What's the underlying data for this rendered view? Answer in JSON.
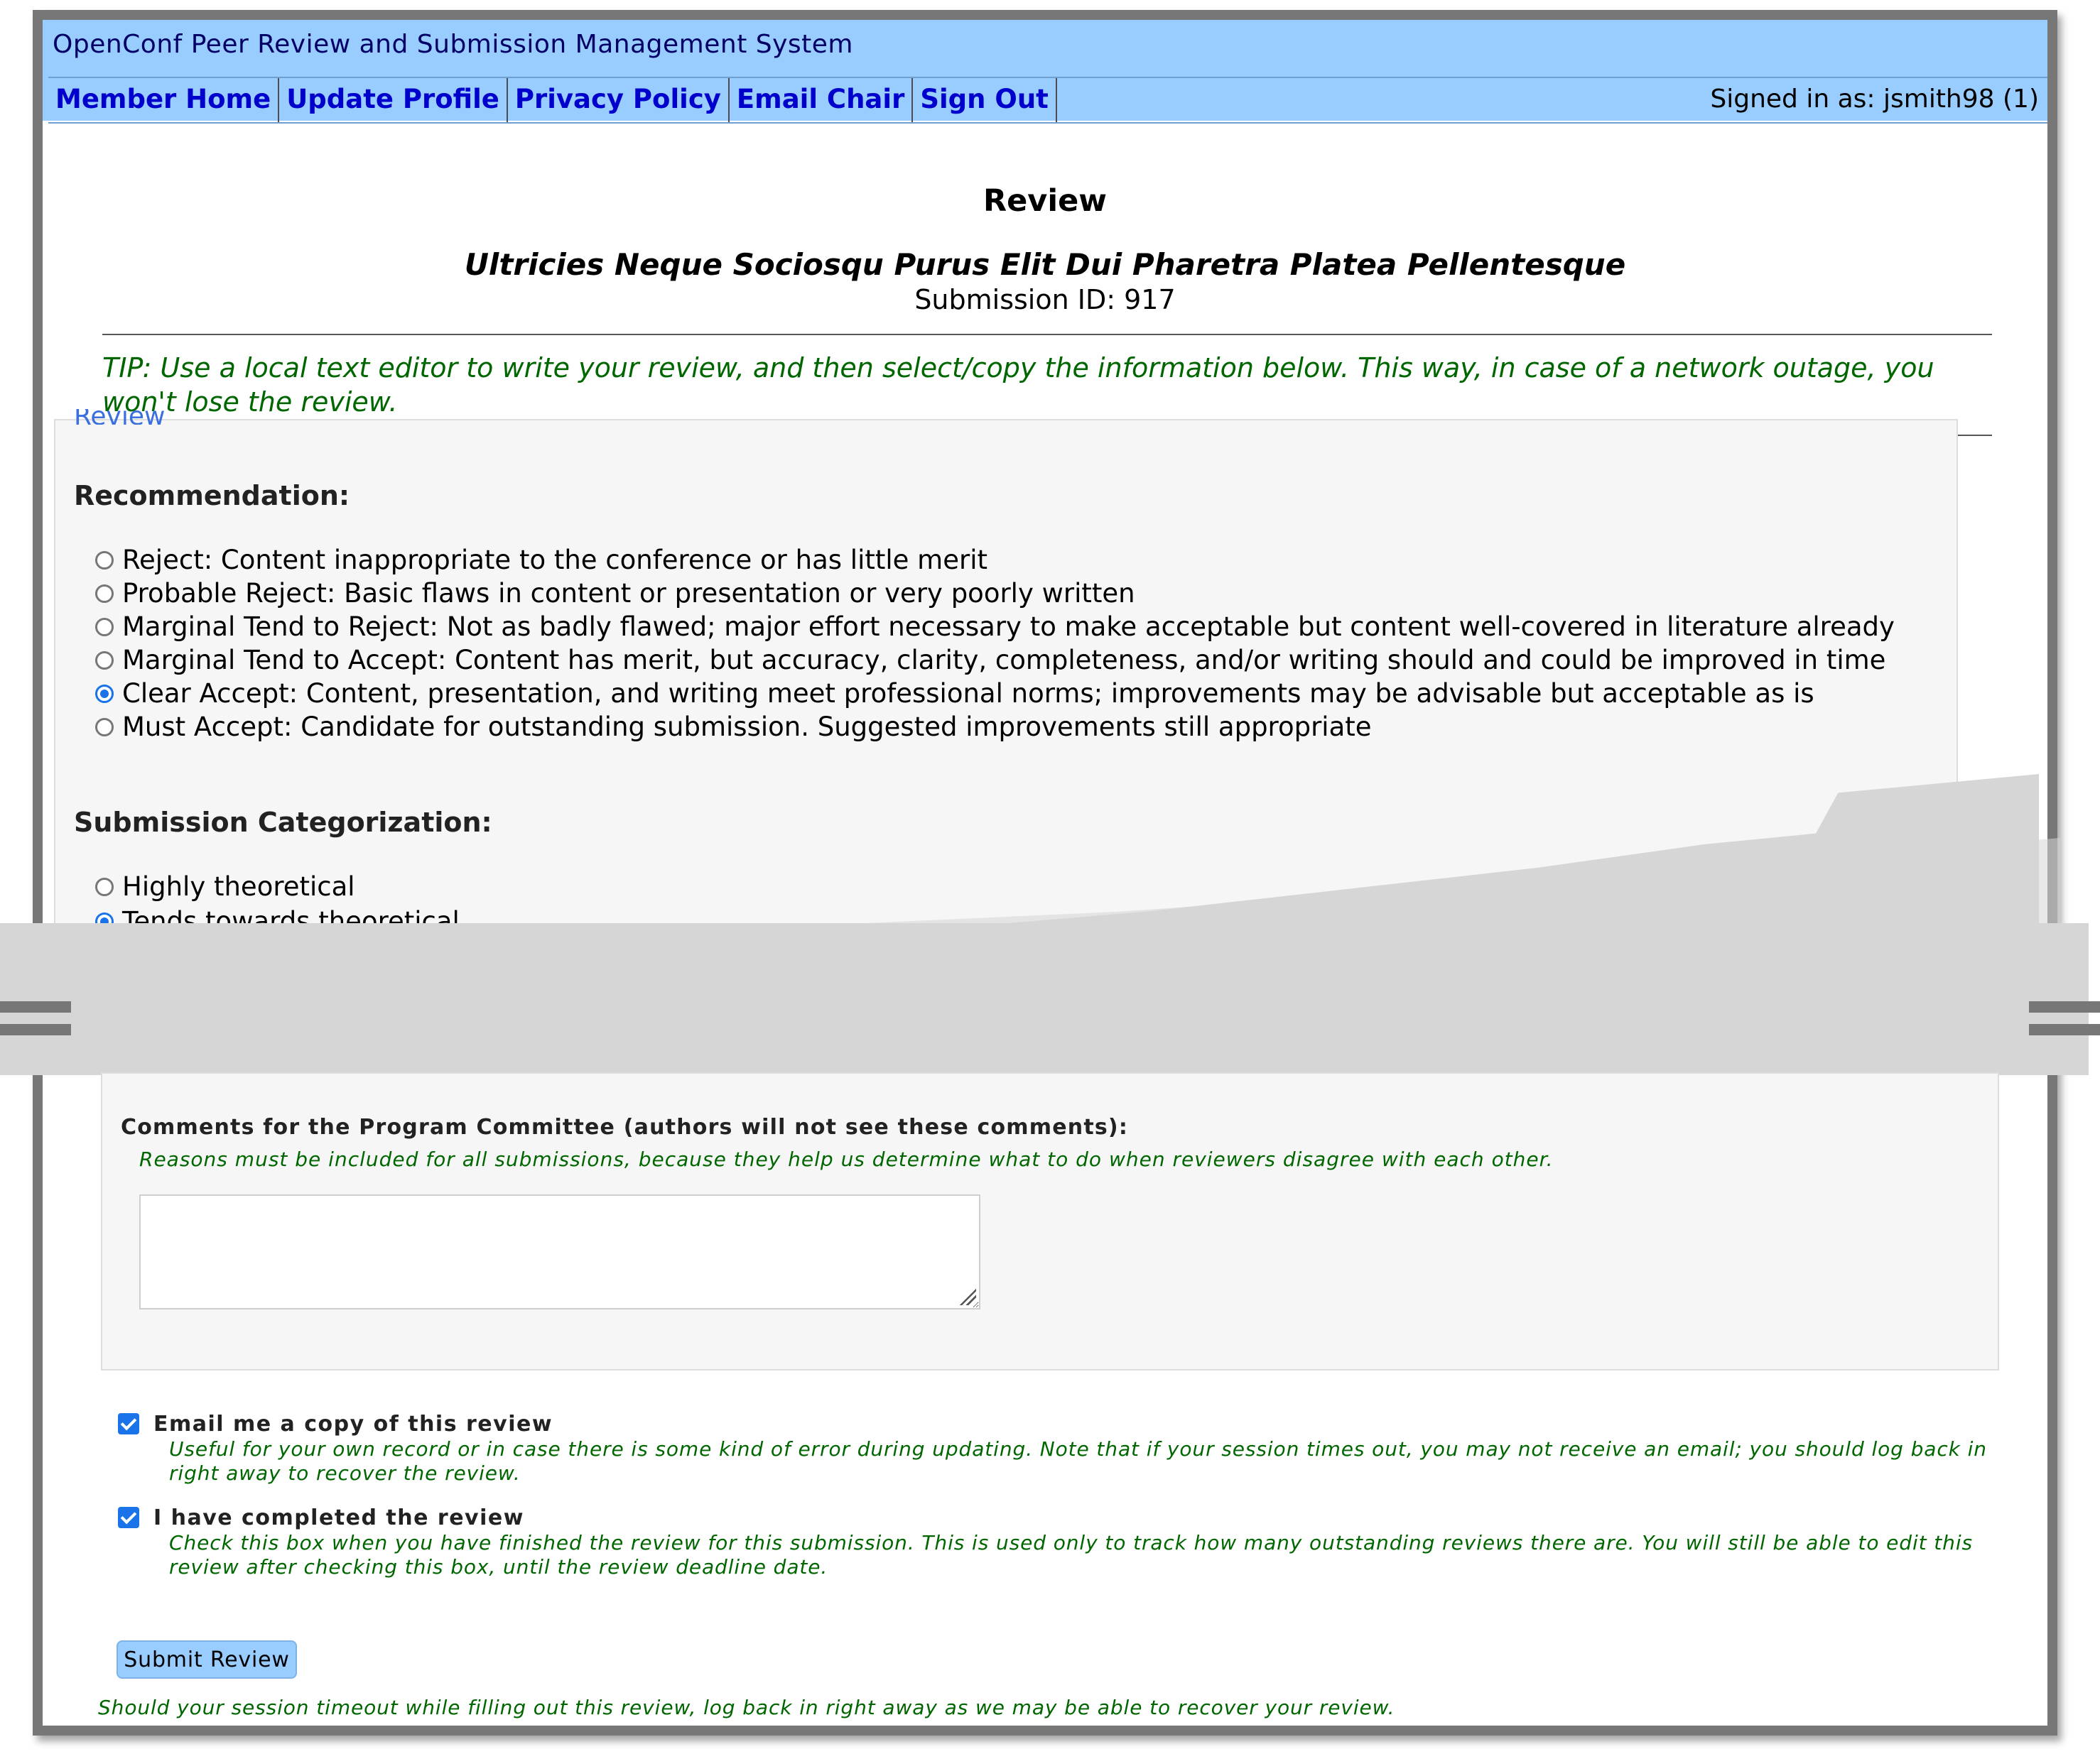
{
  "header": {
    "app_title": "OpenConf Peer Review and Submission Management System",
    "nav": [
      {
        "label": "Member Home"
      },
      {
        "label": "Update Profile"
      },
      {
        "label": "Privacy Policy"
      },
      {
        "label": "Email Chair"
      },
      {
        "label": "Sign Out"
      }
    ],
    "signed_in": "Signed in as: jsmith98 (1)"
  },
  "page": {
    "heading": "Review",
    "submission_title": "Ultricies Neque Sociosqu Purus Elit Dui Pharetra Platea Pellentesque",
    "submission_id": "Submission ID: 917",
    "tip": "TIP: Use a local text editor to write your review, and then select/copy the information below. This way, in case of a network outage, you won't lose the review.",
    "fieldset_legend": "Review"
  },
  "recommendation": {
    "label": "Recommendation:",
    "options": [
      {
        "text": "Reject: Content inappropriate to the conference or has little merit",
        "selected": false
      },
      {
        "text": "Probable Reject: Basic flaws in content or presentation or very poorly written",
        "selected": false
      },
      {
        "text": "Marginal Tend to Reject: Not as badly flawed; major effort necessary to make acceptable but content well-covered in literature already",
        "selected": false
      },
      {
        "text": "Marginal Tend to Accept: Content has merit, but accuracy, clarity, completeness, and/or writing should and could be improved in time",
        "selected": false
      },
      {
        "text": "Clear Accept: Content, presentation, and writing meet professional norms; improvements may be advisable but acceptable as is",
        "selected": true
      },
      {
        "text": "Must Accept: Candidate for outstanding submission. Suggested improvements still appropriate",
        "selected": false
      }
    ]
  },
  "categorization": {
    "label": "Submission Categorization:",
    "options": [
      {
        "text": "Highly theoretical",
        "selected": false
      },
      {
        "text": "Tends towards theoretical",
        "selected": true
      }
    ]
  },
  "comments": {
    "label": "Comments for the Program Committee (authors will not see these comments):",
    "hint": "Reasons must be included for all submissions, because they help us determine what to do when reviewers disagree with each other.",
    "value": ""
  },
  "email_copy": {
    "label": "Email me a copy of this review",
    "checked": true,
    "hint": "Useful for your own record or in case there is some kind of error during updating. Note that if your session times out, you may not receive an email; you should log back in right away to recover the review."
  },
  "completed": {
    "label": "I have completed the review",
    "checked": true,
    "hint": "Check this box when you have finished the review for this submission. This is used only to track how many outstanding reviews there are. You will still be able to edit this review after checking this box, until the review deadline date."
  },
  "submit_label": "Submit Review",
  "footer_note": "Should your session timeout while filling out this review, log back in right away as we may be able to recover your review.",
  "colors": {
    "header_bg": "#99ccff",
    "nav_link": "#0000cc",
    "hint_green": "#006600",
    "accent_blue": "#1a73e8",
    "frame_gray": "#777777"
  }
}
